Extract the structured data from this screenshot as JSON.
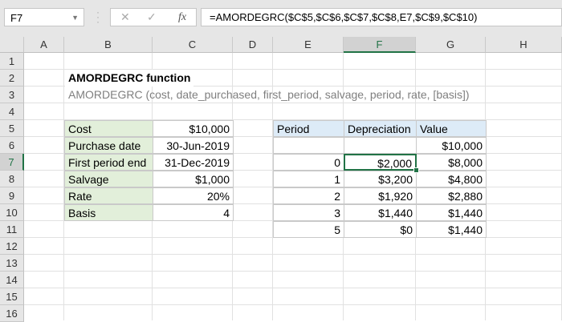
{
  "name_box": "F7",
  "formula_bar": {
    "cancel_icon": "✕",
    "enter_icon": "✓",
    "fx_icon": "fx",
    "formula": "=AMORDEGRC($C$5,$C$6,$C$7,$C$8,E7,$C$9,$C$10)"
  },
  "columns": [
    "A",
    "B",
    "C",
    "D",
    "E",
    "F",
    "G",
    "H"
  ],
  "rows": [
    "1",
    "2",
    "3",
    "4",
    "5",
    "6",
    "7",
    "8",
    "9",
    "10",
    "11",
    "12",
    "13",
    "14",
    "15",
    "16"
  ],
  "title": "AMORDEGRC function",
  "syntax": "AMORDEGRC (cost, date_purchased, first_period, salvage, period, rate, [basis])",
  "inputs": [
    {
      "label": "Cost",
      "value": "$10,000"
    },
    {
      "label": "Purchase date",
      "value": "30-Jun-2019"
    },
    {
      "label": "First period end",
      "value": "31-Dec-2019"
    },
    {
      "label": "Salvage",
      "value": "$1,000"
    },
    {
      "label": "Rate",
      "value": "20%"
    },
    {
      "label": "Basis",
      "value": "4"
    }
  ],
  "table": {
    "headers": [
      "Period",
      "Depreciation",
      "Value"
    ],
    "rows": [
      [
        "",
        "",
        "$10,000"
      ],
      [
        "0",
        "$2,000",
        "$8,000"
      ],
      [
        "1",
        "$3,200",
        "$4,800"
      ],
      [
        "2",
        "$1,920",
        "$2,880"
      ],
      [
        "3",
        "$1,440",
        "$1,440"
      ],
      [
        "5",
        "$0",
        "$1,440"
      ]
    ]
  },
  "colors": {
    "accent": "#217346",
    "label_fill": "#e2efda",
    "header_fill": "#ddebf7"
  }
}
